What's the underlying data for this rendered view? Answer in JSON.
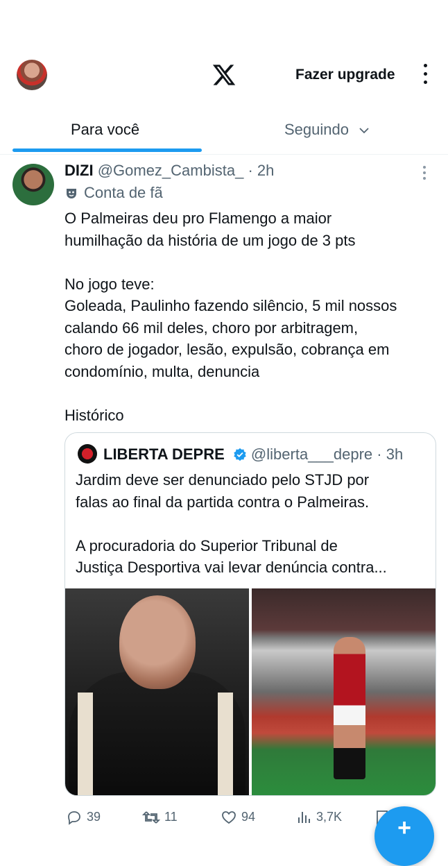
{
  "header": {
    "logo_icon": "x-logo-icon",
    "upgrade_label": "Fazer upgrade",
    "menu_icon": "kebab-icon"
  },
  "tabs": [
    {
      "label": "Para você",
      "active": true
    },
    {
      "label": "Seguindo",
      "active": false
    }
  ],
  "post": {
    "display_name": "DIZI",
    "handle": "@Gomez_Cambista_",
    "separator": " · ",
    "time": "2h",
    "badge": "Conta de fã",
    "lines": [
      "O Palmeiras deu pro Flamengo a maior",
      "humilhação da história de um jogo de 3 pts",
      "",
      "No jogo teve:",
      "Goleada, Paulinho fazendo silêncio, 5 mil nossos",
      "calando 66 mil deles, choro por arbitragem,",
      "choro de jogador, lesão, expulsão, cobrança em",
      "condomínio, multa, denuncia",
      "",
      "Histórico"
    ]
  },
  "quote": {
    "display_name": "LIBERTA DEPRE",
    "handle": "@liberta___depre",
    "separator": " · ",
    "time": "3h",
    "lines": [
      "Jardim deve ser denunciado pelo STJD por",
      "falas ao final da partida contra o Palmeiras.",
      "",
      "A procuradoria do Superior Tribunal de",
      "Justiça Desportiva vai levar denúncia contra..."
    ]
  },
  "actions": {
    "replies": "39",
    "reposts": "11",
    "likes": "94",
    "views": "3,7K"
  },
  "colors": {
    "accent": "#1d9bf0",
    "text": "#0f1419",
    "secondary": "#536471"
  }
}
